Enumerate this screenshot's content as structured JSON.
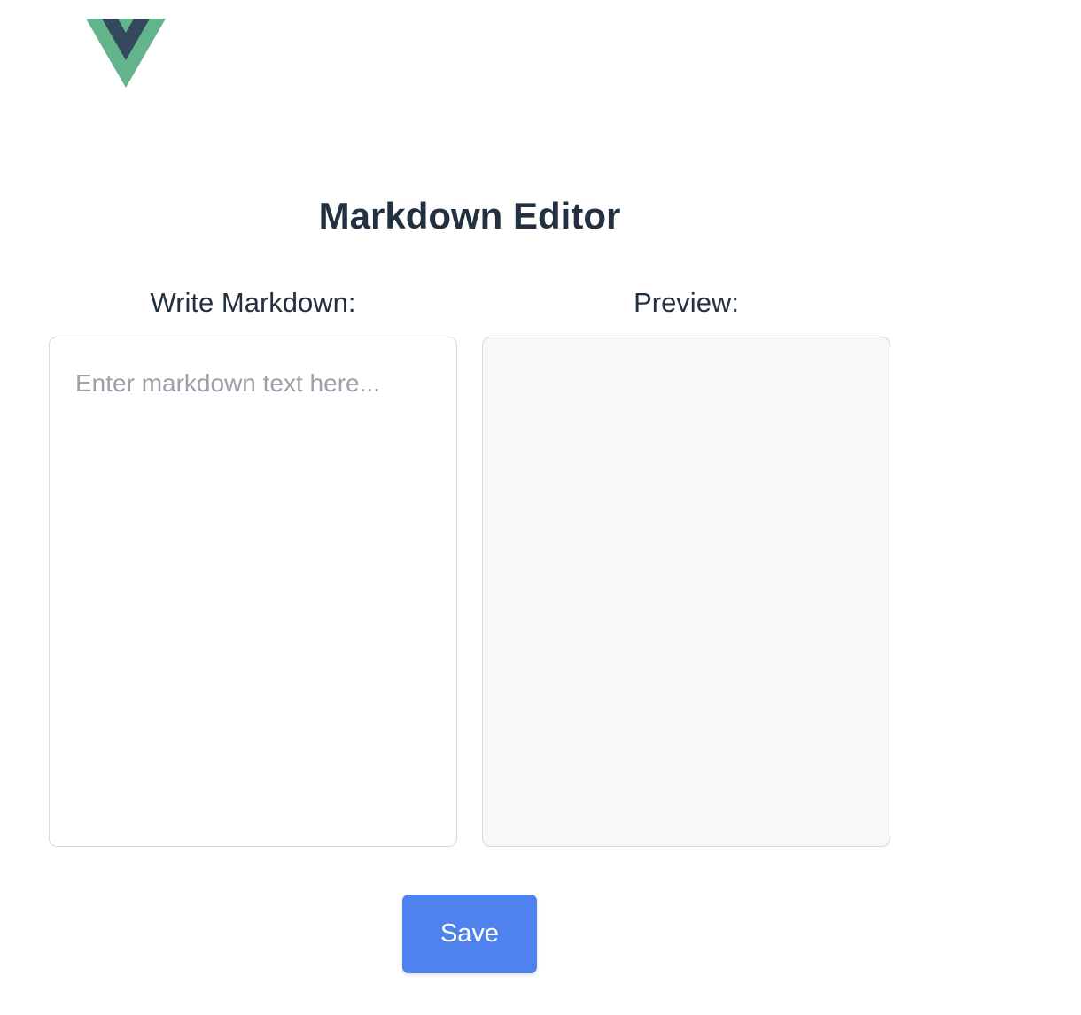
{
  "app": {
    "logo_icon": "vue-logo-icon",
    "brand_colors": {
      "green": "#63b48b",
      "navy": "#35495e"
    }
  },
  "header": {
    "title": "Markdown Editor"
  },
  "editor": {
    "label": "Write Markdown:",
    "value": "",
    "placeholder": "Enter markdown text here..."
  },
  "preview": {
    "label": "Preview:",
    "content": ""
  },
  "actions": {
    "save_label": "Save",
    "accent_color": "#5082ed"
  }
}
